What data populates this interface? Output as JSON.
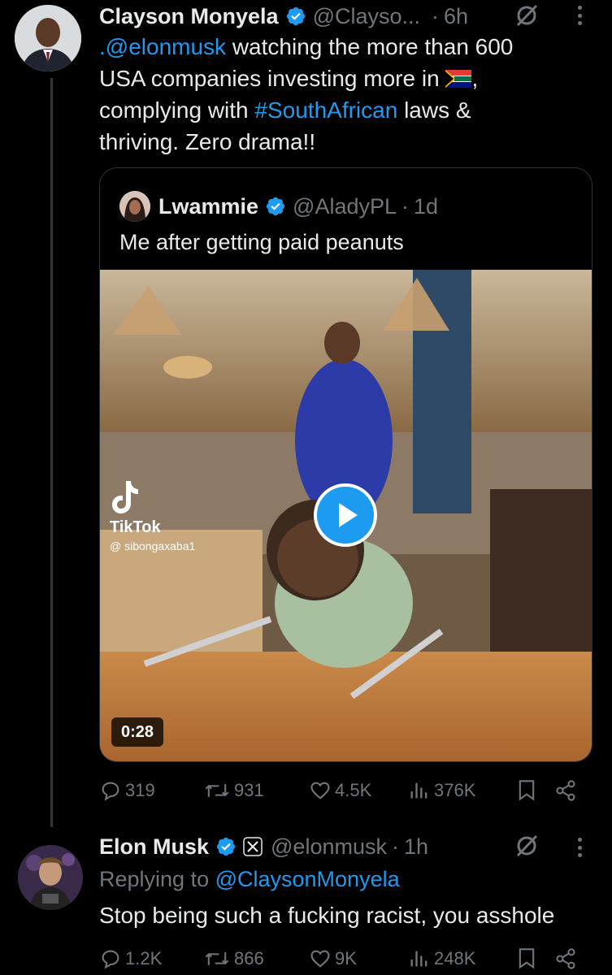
{
  "tweet1": {
    "name": "Clayson Monyela",
    "handle": "@Clayso...",
    "separator": "·",
    "time": "6h",
    "text": {
      "mention": ".@elonmusk",
      "part1": " watching the more than 600",
      "part2": "USA companies investing more in",
      "part3": ",",
      "part4": "complying with ",
      "hashtag": "#SouthAfrican",
      "part5": " laws &",
      "part6": "thriving. Zero drama!!"
    },
    "quote": {
      "name": "Lwammie",
      "handle": "@AladyPL",
      "separator": "·",
      "time": "1d",
      "text": "Me after getting paid peanuts",
      "tiktok_label": "TikTok",
      "tiktok_user": "@ sibongaxaba1",
      "duration": "0:28"
    },
    "stats": {
      "replies": "319",
      "retweets": "931",
      "likes": "4.5K",
      "views": "376K"
    }
  },
  "tweet2": {
    "name": "Elon Musk",
    "handle": "@elonmusk",
    "separator": "·",
    "time": "1h",
    "replying_prefix": "Replying to ",
    "replying_handle": "@ClaysonMonyela",
    "text": "Stop being such a fucking racist, you asshole",
    "stats": {
      "replies": "1.2K",
      "retweets": "866",
      "likes": "9K",
      "views": "248K"
    }
  },
  "colors": {
    "background": "#000000",
    "text": "#e7e9ea",
    "muted": "#71767b",
    "accent": "#1d9bf0",
    "border": "#2f3336"
  },
  "icons": [
    "verified-badge-icon",
    "grok-icon",
    "more-icon",
    "reply-icon",
    "retweet-icon",
    "like-icon",
    "views-icon",
    "bookmark-icon",
    "share-icon",
    "play-icon",
    "tiktok-icon",
    "x-affiliate-icon",
    "south-africa-flag-icon"
  ]
}
